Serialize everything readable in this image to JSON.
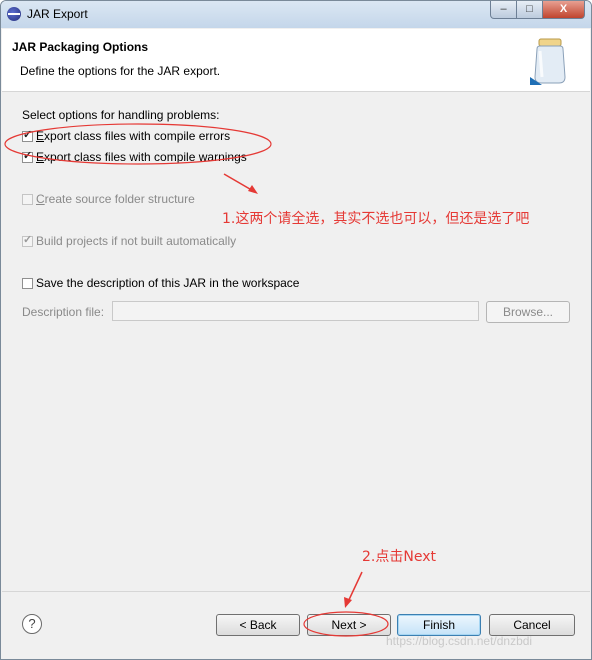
{
  "window": {
    "title": "JAR Export",
    "controls": {
      "minimize": "–",
      "maximize": "□",
      "close": "X"
    }
  },
  "header": {
    "title": "JAR Packaging Options",
    "description": "Define the options for the JAR export."
  },
  "options": {
    "section_label": "Select options for handling problems:",
    "export_errors": {
      "label": "Export class files with compile errors",
      "checked": true,
      "enabled": true
    },
    "export_warnings": {
      "label": "Export class files with compile warnings",
      "checked": true,
      "enabled": true
    },
    "create_source_folder": {
      "label": "Create source folder structure",
      "checked": false,
      "enabled": false
    },
    "build_projects": {
      "label": "Build projects if not built automatically",
      "checked": true,
      "enabled": false
    },
    "save_description": {
      "label": "Save the description of this JAR in the workspace",
      "checked": false,
      "enabled": true
    }
  },
  "description_file": {
    "label": "Description file:",
    "value": "",
    "browse_label": "Browse..."
  },
  "footer": {
    "help_icon": "?",
    "back_label": "< Back",
    "next_label": "Next >",
    "finish_label": "Finish",
    "cancel_label": "Cancel"
  },
  "annotations": {
    "note1": "1.这两个请全选，其实不选也可以，但还是选了吧",
    "note2": "2.点击Next",
    "color": "#e53935"
  },
  "watermark": "https://blog.csdn.net/dnzbdi"
}
